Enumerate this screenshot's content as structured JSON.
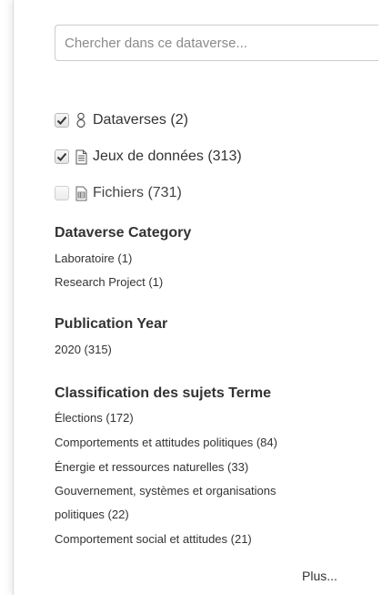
{
  "search": {
    "placeholder": "Chercher dans ce dataverse..."
  },
  "types": [
    {
      "label": "Dataverses (2)",
      "checked": true,
      "icon": "dataverse-icon"
    },
    {
      "label": "Jeux de données (313)",
      "checked": true,
      "icon": "dataset-file-icon"
    },
    {
      "label": "Fichiers (731)",
      "checked": false,
      "icon": "file-table-icon"
    }
  ],
  "facets": [
    {
      "title": "Dataverse Category",
      "items": [
        "Laboratoire (1)",
        "Research Project (1)"
      ]
    },
    {
      "title": "Publication Year",
      "items": [
        "2020 (315)"
      ]
    },
    {
      "title": "Classification des sujets Terme",
      "items": [
        "Élections (172)",
        "Comportements et attitudes politiques (84)",
        "Énergie et ressources naturelles (33)",
        "Gouvernement, systèmes et organisations",
        "politiques (22)",
        "Comportement social et attitudes (21)"
      ]
    }
  ],
  "more_label": "Plus...",
  "colors": {
    "text": "#333333",
    "border": "#cccccc",
    "check": "#333333"
  }
}
